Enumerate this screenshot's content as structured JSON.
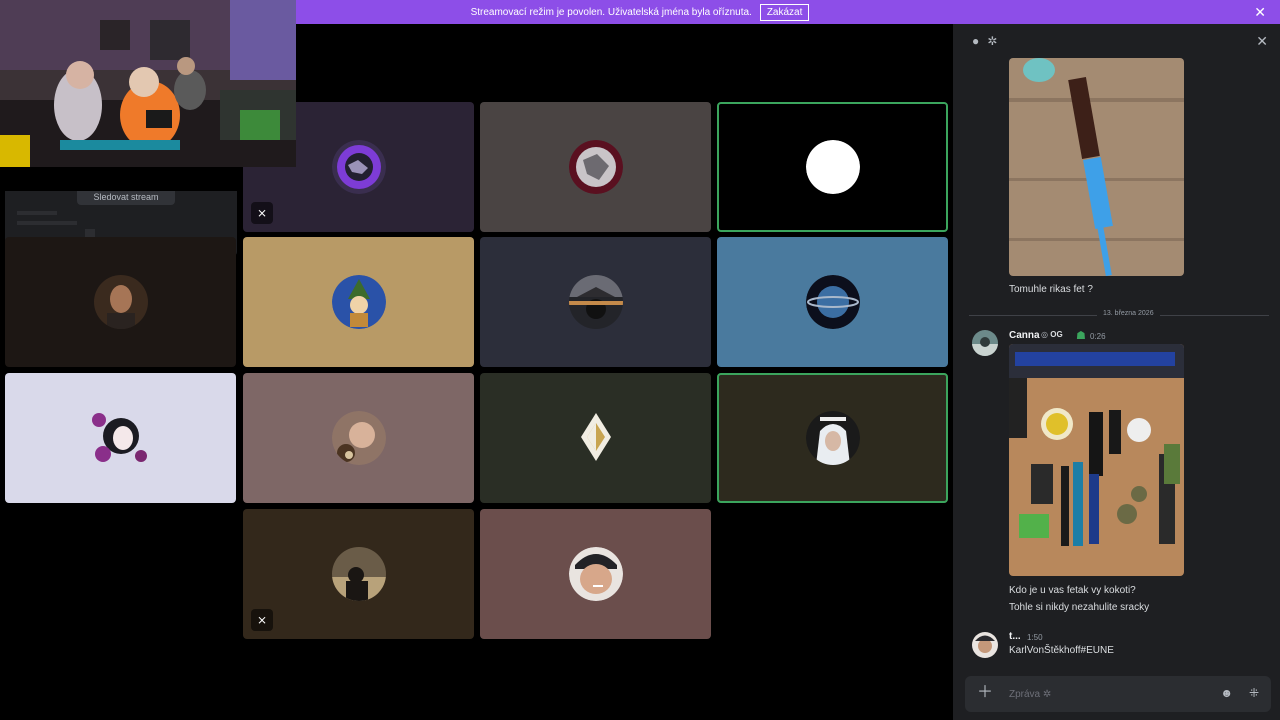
{
  "banner": {
    "message": "Streamovací režim je povolen. Uživatelská jména byla oříznuta.",
    "disable_label": "Zakázat",
    "close": "✕"
  },
  "stream": {
    "watch_label": "Sledovat stream"
  },
  "tiles": [
    {
      "bg": "#2b2335",
      "avatar": "purple-orb-avatar",
      "muted": true
    },
    {
      "bg": "#4a4443",
      "avatar": "red-white-orb-avatar",
      "muted": false
    },
    {
      "bg": "#000000",
      "avatar": "white-circle-avatar",
      "muted": false,
      "speaking": true
    },
    {
      "bg": "#1d1714",
      "avatar": "man-portrait-avatar",
      "muted": false
    },
    {
      "bg": "#b89a66",
      "avatar": "wizard-cartoon-avatar",
      "muted": false
    },
    {
      "bg": "#2c2e3a",
      "avatar": "sunset-hat-avatar",
      "muted": false
    },
    {
      "bg": "#4a7a9e",
      "avatar": "planet-avatar",
      "muted": false
    },
    {
      "bg": "#d9d9ea",
      "avatar": "anime-girl-roses-avatar",
      "muted": false
    },
    {
      "bg": "#7e6766",
      "avatar": "monkey-avatar",
      "muted": false
    },
    {
      "bg": "#2a2e25",
      "avatar": "valorant-rank-avatar",
      "muted": false
    },
    {
      "bg": "#2d2a1e",
      "avatar": "hooded-girl-avatar",
      "muted": false,
      "speaking": true
    },
    {
      "bg": "#33281b",
      "avatar": "night-people-avatar",
      "muted": true
    },
    {
      "bg": "#6b4e4c",
      "avatar": "smoking-guy-avatar",
      "muted": false
    }
  ],
  "chat": {
    "messages": [
      {
        "text": "Tomuhle rikas fet ?"
      },
      {
        "author": "Canna",
        "tag": "OG",
        "time": "0:26",
        "lines": [
          "Kdo je u vas fetak vy kokoti?",
          "Tohle si nikdy nezahulite sracky"
        ]
      },
      {
        "author": "t...",
        "time": "1:50",
        "lines": [
          "KarlVonŠtěkhoff#EUNE"
        ]
      }
    ],
    "date_divider": "13. března 2026",
    "composer_placeholder": "Zpráva ✲"
  },
  "colors": {
    "banner": "#8d4ee8",
    "speaking_outline": "#3ba55d",
    "chat_bg": "#1e1f22"
  }
}
